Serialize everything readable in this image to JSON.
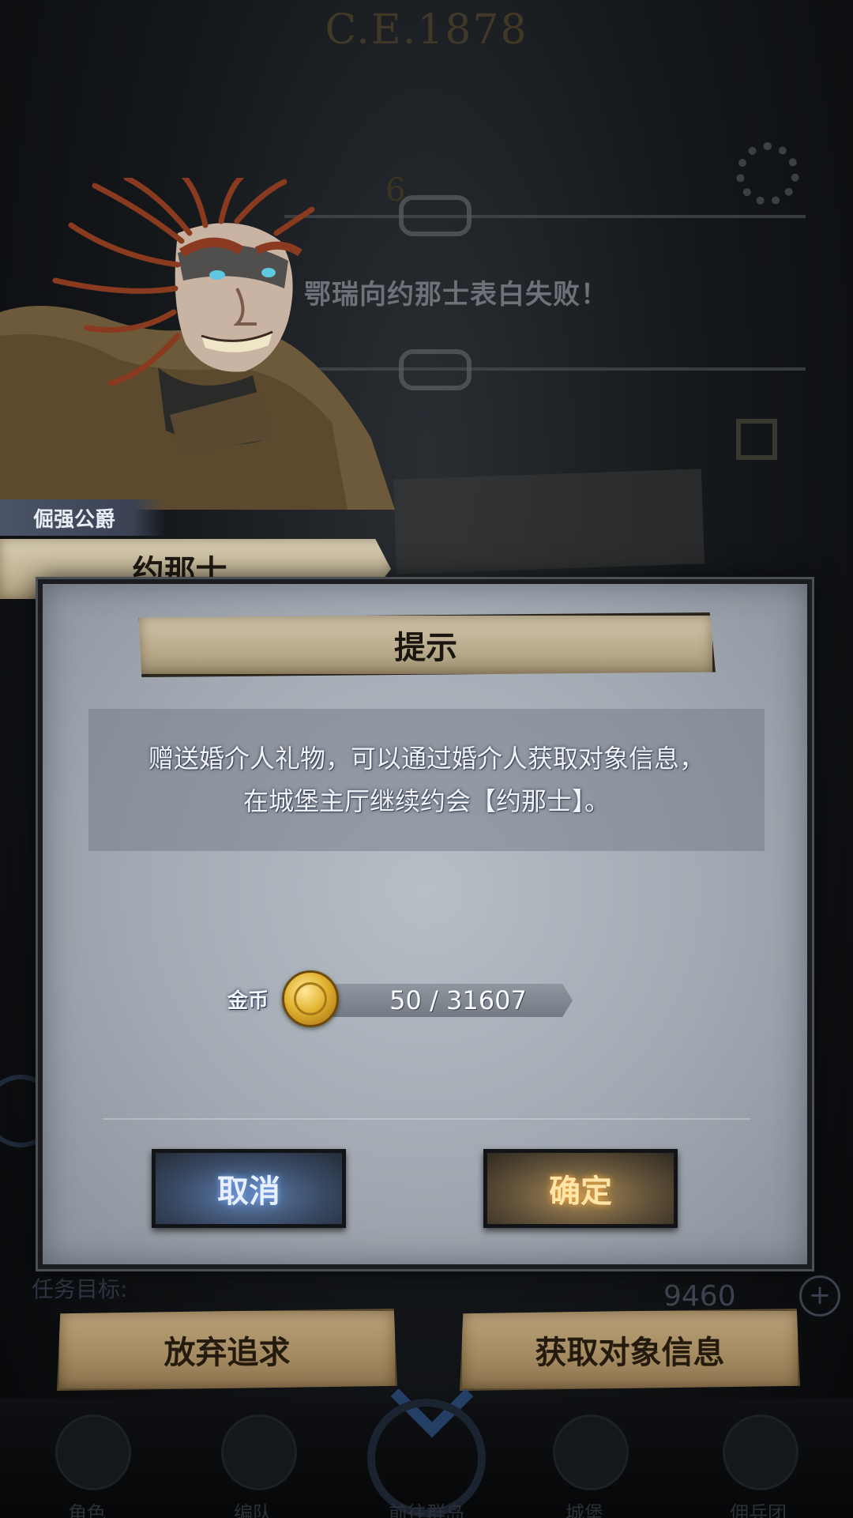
{
  "background": {
    "year": "C.E.1878",
    "counter": "6",
    "event_message": "鄂瑞向约那士表白失败！",
    "gold_amount": "9460",
    "task_label": "任务目标:"
  },
  "character": {
    "rank": "倔强公爵",
    "name": "约那士"
  },
  "dialog": {
    "title": "提示",
    "message_line1": "赠送婚介人礼物，可以通过婚介人获取对象信息，",
    "message_line2": "在城堡主厅继续约会【约那士】。",
    "currency": {
      "label": "金币",
      "value": "50 / 31607",
      "icon": "gold-coin-icon"
    },
    "cancel_label": "取消",
    "confirm_label": "确定"
  },
  "actions": {
    "give_up_label": "放弃追求",
    "get_info_label": "获取对象信息"
  },
  "tabs": [
    {
      "label": "角色"
    },
    {
      "label": "编队"
    },
    {
      "label": "前往群岛"
    },
    {
      "label": "城堡"
    },
    {
      "label": "佣兵团"
    }
  ]
}
